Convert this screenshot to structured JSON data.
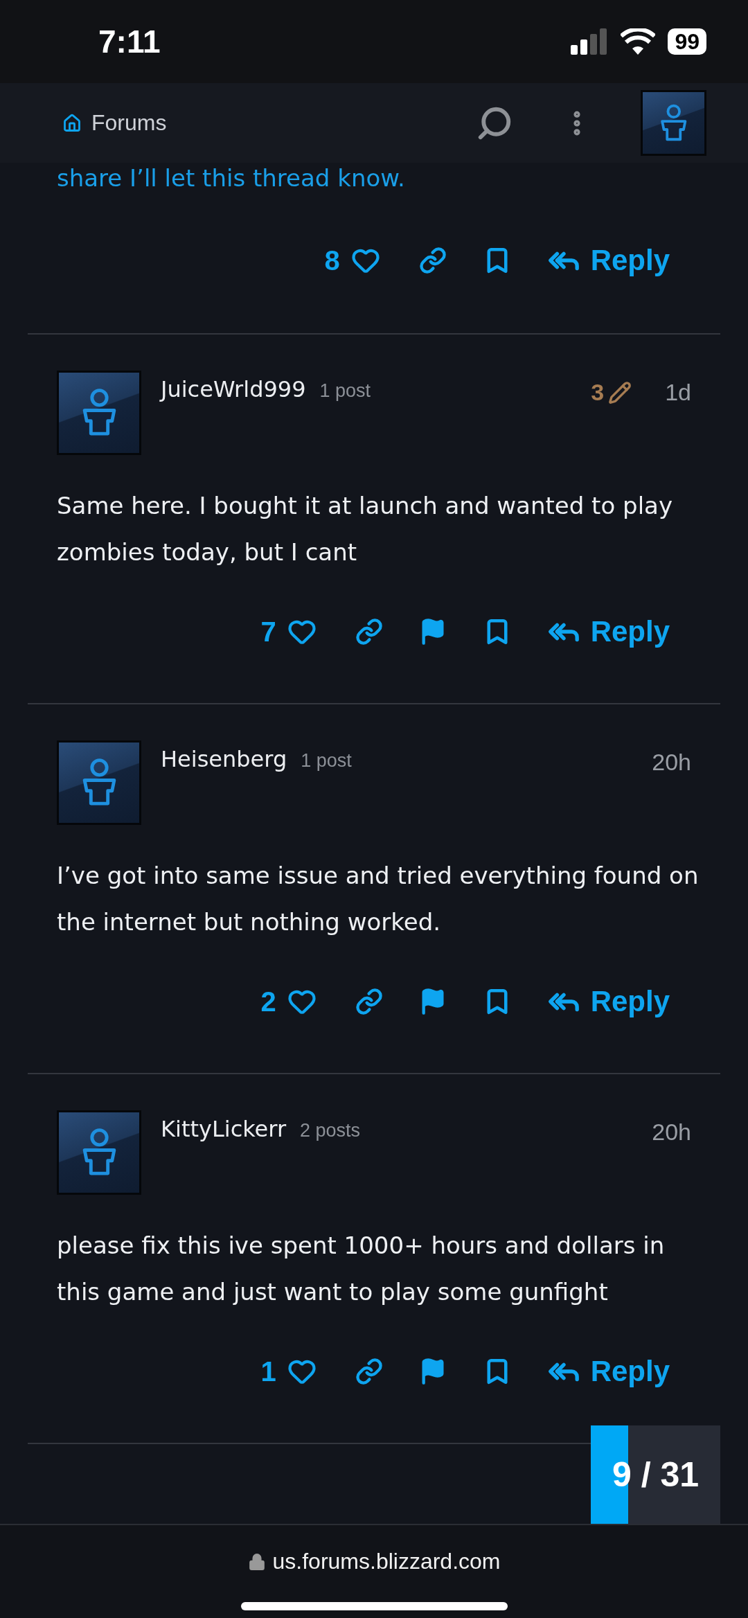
{
  "status_bar": {
    "time": "7:11",
    "battery": "99"
  },
  "header": {
    "breadcrumb": "Forums"
  },
  "partial_post": {
    "body": "share I’ll let this thread know.",
    "likes": "8",
    "actions": [
      {
        "kind": "link"
      },
      {
        "kind": "bookmark"
      }
    ],
    "reply": "Reply"
  },
  "posts": [
    {
      "author": "JuiceWrld999",
      "post_count": "1 post",
      "edits": "3",
      "age": "1d",
      "body": "Same here. I bought it at launch and wanted to play zombies today, but I cant",
      "likes": "7",
      "actions": [
        {
          "kind": "link"
        },
        {
          "kind": "flag"
        },
        {
          "kind": "bookmark"
        }
      ],
      "reply": "Reply"
    },
    {
      "author": "Heisenberg",
      "post_count": "1 post",
      "age": "20h",
      "body": "I’ve got into same issue and tried everything found on the internet but nothing worked.",
      "likes": "2",
      "actions": [
        {
          "kind": "link"
        },
        {
          "kind": "flag"
        },
        {
          "kind": "bookmark"
        }
      ],
      "reply": "Reply"
    },
    {
      "author": "KittyLickerr",
      "post_count": "2 posts",
      "age": "20h",
      "body": "please fix this ive spent 1000+ hours and dollars in this game and just want to play some gunfight",
      "likes": "1",
      "actions": [
        {
          "kind": "link"
        },
        {
          "kind": "flag"
        },
        {
          "kind": "bookmark"
        }
      ],
      "reply": "Reply"
    }
  ],
  "progress": {
    "current": "9",
    "separator": "/",
    "total": "31",
    "level": 0.29
  },
  "address_bar": {
    "url": "us.forums.blizzard.com"
  }
}
